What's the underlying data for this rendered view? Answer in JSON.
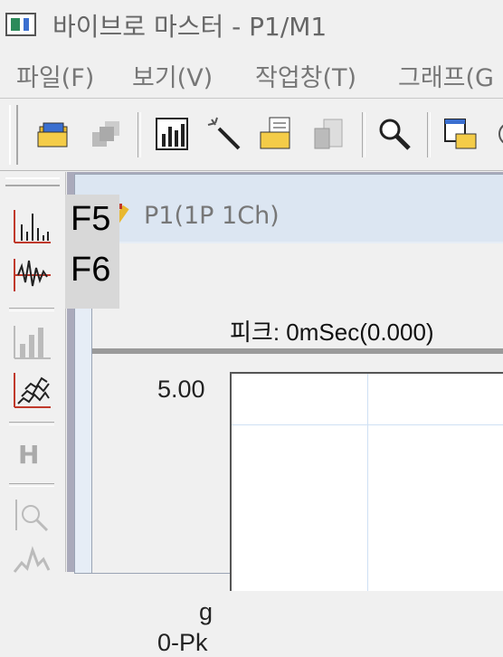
{
  "window": {
    "title": "바이브로 마스터 - P1/M1"
  },
  "menu": {
    "items": [
      "파일(F)",
      "보기(V)",
      "작업창(T)",
      "그래프(G"
    ]
  },
  "tooltip": {
    "line1": "F5",
    "line2": "F6"
  },
  "left_toolbar": {
    "h_label": "H"
  },
  "child_window": {
    "title": "P1(1P 1Ch)",
    "peak_label": "피크: 0mSec(0.000)",
    "y_max": "5.00",
    "unit": "g",
    "unit2": "0-Pk"
  },
  "icons": [
    "open-folder-icon",
    "network-icon",
    "bar-chart-icon",
    "magic-wand-icon",
    "folder-doc-icon",
    "save-doc-icon",
    "magnify-icon",
    "window-folder-icon",
    "waterfall-icon",
    "wave-icon"
  ],
  "colors": {
    "accent_red": "#c0392b",
    "toolbar_bg": "#f0f0f0",
    "child_title_bg": "#dce6f2"
  }
}
